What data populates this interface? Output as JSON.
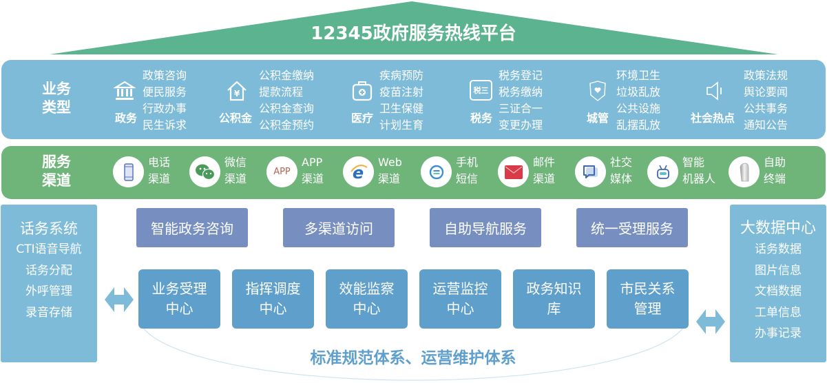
{
  "title": "12345政府服务热线平台",
  "colors": {
    "roof": "#5bb38f",
    "business_band": "#7dbbd8",
    "channel_band": "#6fb57a",
    "service_box": "#778fc0",
    "center_box": "#5f9fcc",
    "side_panel": "#7dbbd8",
    "standard_text": "#5f9fcc"
  },
  "business": {
    "label": [
      "业务",
      "类型"
    ],
    "groups": [
      {
        "name": "政务",
        "icon": "government-building-icon",
        "items": [
          "政策咨询",
          "便民服务",
          "行政办事",
          "民生诉求"
        ]
      },
      {
        "name": "公积金",
        "icon": "housing-fund-icon",
        "items": [
          "公积金缴纳",
          "提款流程",
          "公积金查询",
          "公积金预约"
        ]
      },
      {
        "name": "医疗",
        "icon": "medical-kit-icon",
        "items": [
          "疾病预防",
          "疫苗注射",
          "卫生保健",
          "计划生育"
        ]
      },
      {
        "name": "税务",
        "icon": "tax-icon",
        "icon_text": "税三",
        "items": [
          "税务登记",
          "税务缴纳",
          "三证合一",
          "变更办理"
        ]
      },
      {
        "name": "城管",
        "icon": "shield-heart-icon",
        "items": [
          "环境卫生",
          "垃圾乱放",
          "公共设施",
          "乱摆乱放"
        ]
      },
      {
        "name": "社会热点",
        "icon": "speaker-icon",
        "items": [
          "政策法规",
          "舆论要闻",
          "公共事务",
          "通知公告"
        ]
      }
    ]
  },
  "channels": {
    "label": [
      "服务",
      "渠道"
    ],
    "items": [
      {
        "line1": "电话",
        "line2": "渠道",
        "icon": "phone-icon"
      },
      {
        "line1": "微信",
        "line2": "渠道",
        "icon": "wechat-icon"
      },
      {
        "line1": "APP",
        "line2": "渠道",
        "icon": "app-icon",
        "icon_text": "APP"
      },
      {
        "line1": "Web",
        "line2": "渠道",
        "icon": "web-browser-icon"
      },
      {
        "line1": "手机",
        "line2": "短信",
        "icon": "sms-icon"
      },
      {
        "line1": "邮件",
        "line2": "渠道",
        "icon": "mail-icon"
      },
      {
        "line1": "社交",
        "line2": "媒体",
        "icon": "social-chat-icon"
      },
      {
        "line1": "智能",
        "line2": "机器人",
        "icon": "robot-icon"
      },
      {
        "line1": "自助",
        "line2": "终端",
        "icon": "kiosk-icon"
      }
    ]
  },
  "left_panel": {
    "title": "话务系统",
    "items": [
      "CTI语音导航",
      "话务分配",
      "外呼管理",
      "录音存储"
    ]
  },
  "right_panel": {
    "title": "大数据中心",
    "items": [
      "话务数据",
      "图片信息",
      "文档数据",
      "工单信息",
      "办事记录"
    ]
  },
  "services": [
    "智能政务咨询",
    "多渠道访问",
    "自助导航服务",
    "统一受理服务"
  ],
  "centers": [
    {
      "line1": "业务受理",
      "line2": "中心"
    },
    {
      "line1": "指挥调度",
      "line2": "中心"
    },
    {
      "line1": "效能监察",
      "line2": "中心"
    },
    {
      "line1": "运营监控",
      "line2": "中心"
    },
    {
      "line1": "政务知识",
      "line2": "库"
    },
    {
      "line1": "市民关系",
      "line2": "管理"
    }
  ],
  "standards": "标准规范体系、运营维护体系"
}
